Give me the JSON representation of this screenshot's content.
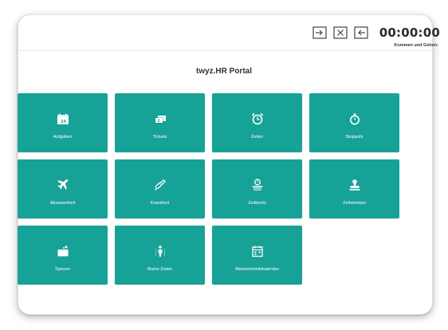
{
  "header": {
    "timer": "00:00:00",
    "clock_caption": "Kommen und Gehen:"
  },
  "page_title": "twyz.HR Portal",
  "tiles": [
    {
      "label": "Aufgaben",
      "icon": "calendar-24-icon"
    },
    {
      "label": "Tickets",
      "icon": "tickets-icon"
    },
    {
      "label": "Zeiten",
      "icon": "alarm-clock-icon"
    },
    {
      "label": "Stoppuhr",
      "icon": "stopwatch-icon"
    },
    {
      "label": "Abwesenheit",
      "icon": "airplane-icon"
    },
    {
      "label": "Krankheit",
      "icon": "thermometer-icon"
    },
    {
      "label": "Zeitkonto",
      "icon": "time-account-icon"
    },
    {
      "label": "Zeitstempel",
      "icon": "stamp-icon"
    },
    {
      "label": "Spesen",
      "icon": "wallet-icon"
    },
    {
      "label": "Meine Daten",
      "icon": "person-icon"
    },
    {
      "label": "Abwesenheitskalender",
      "icon": "absence-calendar-icon"
    }
  ],
  "colors": {
    "tile": "#17a297",
    "text_dark": "#2b2b2b"
  }
}
